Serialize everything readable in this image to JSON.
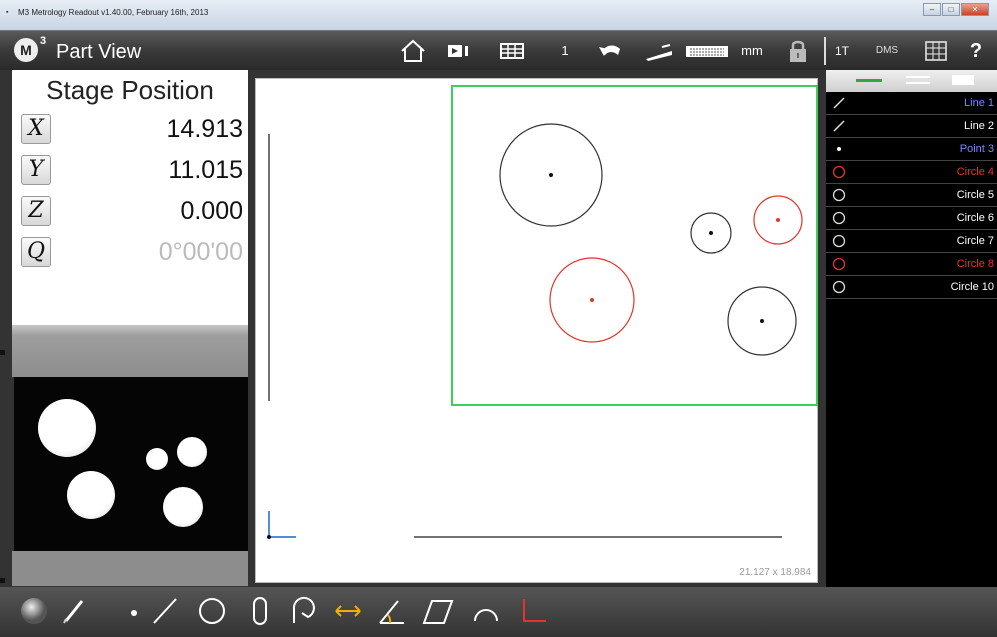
{
  "window": {
    "title": "M3 Metrology Readout  v1.40.00, February 16th, 2013",
    "controls": [
      "minimize",
      "maximize",
      "close"
    ]
  },
  "toolbar": {
    "logo": "M",
    "logo_sup": "3",
    "title": "Part View",
    "count": "1",
    "units": "mm",
    "mode_1t": "1T",
    "angle_format": "DMS",
    "help": "?",
    "icons": [
      "home-icon",
      "record-icon",
      "grid-icon",
      "undo-icon",
      "probe-icon",
      "keyboard-icon",
      "lock-icon",
      "table-icon"
    ]
  },
  "stage": {
    "title": "Stage Position",
    "axes": [
      {
        "label": "X",
        "value": "14.913"
      },
      {
        "label": "Y",
        "value": "11.015"
      },
      {
        "label": "Z",
        "value": "0.000"
      },
      {
        "label": "Q",
        "value": "0°00'00"
      }
    ]
  },
  "canvas": {
    "dimensions": "21.127 x 18.984",
    "colors": {
      "box": "#3ccf5a",
      "normal": "#333333",
      "selected": "#e0352a",
      "axis_x": "#1565d8",
      "axis_y": "#1565d8"
    }
  },
  "features": [
    {
      "name": "Line 1",
      "type": "line",
      "color": "#6f8cff",
      "icon": "line-icon"
    },
    {
      "name": "Line 2",
      "type": "line",
      "color": "#ffffff",
      "icon": "line-icon"
    },
    {
      "name": "Point 3",
      "type": "point",
      "color": "#6f8cff",
      "icon": "point-icon"
    },
    {
      "name": "Circle 4",
      "type": "circle",
      "color": "#e0352a",
      "icon": "circle-icon"
    },
    {
      "name": "Circle 5",
      "type": "circle",
      "color": "#ffffff",
      "icon": "circle-icon"
    },
    {
      "name": "Circle 6",
      "type": "circle",
      "color": "#ffffff",
      "icon": "circle-icon"
    },
    {
      "name": "Circle 7",
      "type": "circle",
      "color": "#ffffff",
      "icon": "circle-icon"
    },
    {
      "name": "Circle 8",
      "type": "circle",
      "color": "#e0352a",
      "icon": "circle-icon"
    },
    {
      "name": "Circle 10",
      "type": "circle",
      "color": "#ffffff",
      "icon": "circle-icon"
    }
  ],
  "bottom_tools": [
    "sphere-icon",
    "probe-pen-icon",
    "point-tool-icon",
    "line-tool-icon",
    "circle-tool-icon",
    "slot-tool-icon",
    "arc-tool-icon",
    "distance-tool-icon",
    "angle-tool-icon",
    "plane-tool-icon",
    "arc-curve-icon",
    "origin-tool-icon"
  ]
}
